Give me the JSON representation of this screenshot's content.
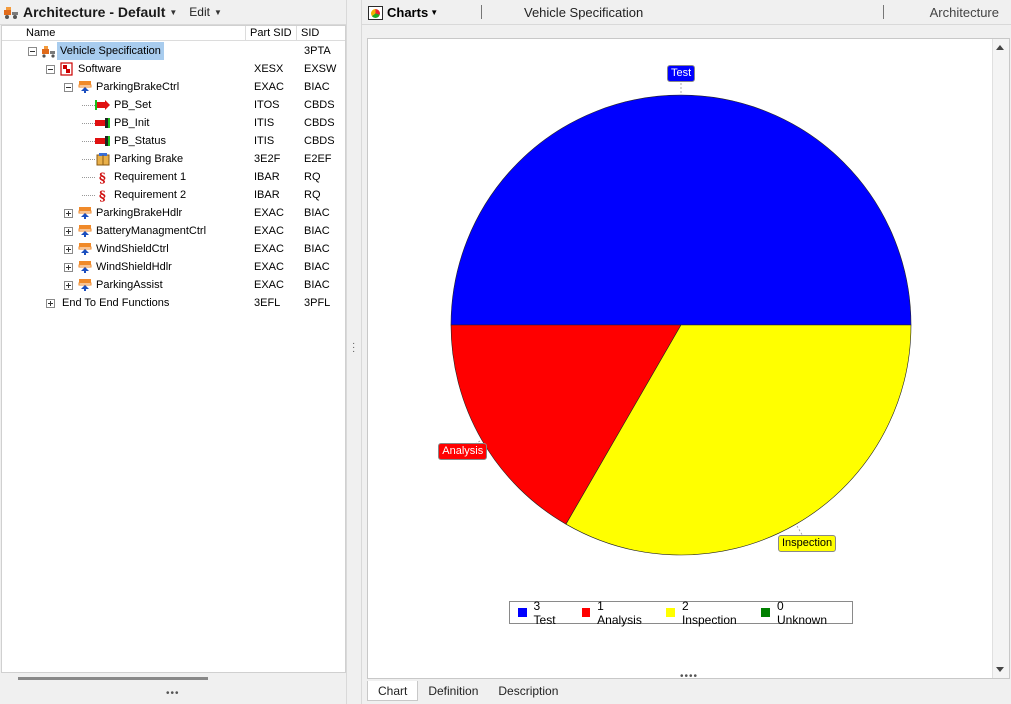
{
  "left_pane": {
    "title": "Architecture - Default",
    "edit_menu": "Edit",
    "columns": {
      "name": "Name",
      "part_sid": "Part SID",
      "sid": "SID"
    },
    "tree": [
      {
        "label": "Vehicle Specification",
        "part_sid": "",
        "sid": "3PTA",
        "level": 0,
        "toggle": "minus",
        "icon": "vehicle-spec-icon",
        "selected": true
      },
      {
        "label": "Software",
        "part_sid": "XESX",
        "sid": "EXSW",
        "level": 1,
        "toggle": "minus",
        "icon": "software-icon"
      },
      {
        "label": "ParkingBrakeCtrl",
        "part_sid": "EXAC",
        "sid": "BIAC",
        "level": 2,
        "toggle": "minus",
        "icon": "component-icon"
      },
      {
        "label": "PB_Set",
        "part_sid": "ITOS",
        "sid": "CBDS",
        "level": 3,
        "toggle": "",
        "icon": "output-port-icon"
      },
      {
        "label": "PB_Init",
        "part_sid": "ITIS",
        "sid": "CBDS",
        "level": 3,
        "toggle": "",
        "icon": "input-port-icon"
      },
      {
        "label": "PB_Status",
        "part_sid": "ITIS",
        "sid": "CBDS",
        "level": 3,
        "toggle": "",
        "icon": "input-port-icon"
      },
      {
        "label": "Parking Brake",
        "part_sid": "3E2F",
        "sid": "E2EF",
        "level": 3,
        "toggle": "",
        "icon": "function-package-icon"
      },
      {
        "label": "Requirement 1",
        "part_sid": "IBAR",
        "sid": "RQ",
        "level": 3,
        "toggle": "",
        "icon": "requirement-icon"
      },
      {
        "label": "Requirement 2",
        "part_sid": "IBAR",
        "sid": "RQ",
        "level": 3,
        "toggle": "",
        "icon": "requirement-icon"
      },
      {
        "label": "ParkingBrakeHdlr",
        "part_sid": "EXAC",
        "sid": "BIAC",
        "level": 2,
        "toggle": "plus",
        "icon": "component-icon"
      },
      {
        "label": "BatteryManagmentCtrl",
        "part_sid": "EXAC",
        "sid": "BIAC",
        "level": 2,
        "toggle": "plus",
        "icon": "component-icon"
      },
      {
        "label": "WindShieldCtrl",
        "part_sid": "EXAC",
        "sid": "BIAC",
        "level": 2,
        "toggle": "plus",
        "icon": "component-icon"
      },
      {
        "label": "WindShieldHdlr",
        "part_sid": "EXAC",
        "sid": "BIAC",
        "level": 2,
        "toggle": "plus",
        "icon": "component-icon"
      },
      {
        "label": "ParkingAssist",
        "part_sid": "EXAC",
        "sid": "BIAC",
        "level": 2,
        "toggle": "plus",
        "icon": "component-icon"
      },
      {
        "label": "End To End Functions",
        "part_sid": "3EFL",
        "sid": "3PFL",
        "level": 1,
        "toggle": "plus",
        "icon": ""
      }
    ]
  },
  "right_pane": {
    "tool_label": "Charts",
    "chart_title": "Vehicle Specification",
    "context_label": "Architecture",
    "tabs": [
      "Chart",
      "Definition",
      "Description"
    ],
    "active_tab": "Chart"
  },
  "chart_data": {
    "type": "pie",
    "slices": [
      {
        "name": "Test",
        "value": 3,
        "color": "#0000ff",
        "text_color": "#ffffff"
      },
      {
        "name": "Analysis",
        "value": 1,
        "color": "#ff0000",
        "text_color": "#ffffff"
      },
      {
        "name": "Inspection",
        "value": 2,
        "color": "#ffff00",
        "text_color": "#000000"
      },
      {
        "name": "Unknown",
        "value": 0,
        "color": "#008000",
        "text_color": "#ffffff"
      }
    ],
    "legend": [
      {
        "label": "3 Test",
        "color": "#0000ff"
      },
      {
        "label": "1 Analysis",
        "color": "#ff0000"
      },
      {
        "label": "2 Inspection",
        "color": "#ffff00"
      },
      {
        "label": "0 Unknown",
        "color": "#008000"
      }
    ],
    "legend_position": "bottom"
  }
}
